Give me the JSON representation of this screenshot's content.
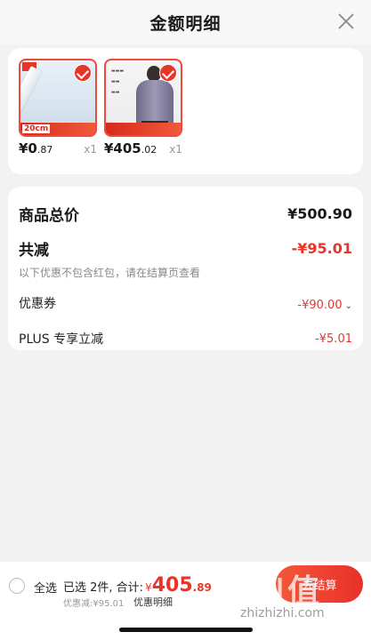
{
  "header": {
    "title": "金额明细",
    "close_icon": "close-icon"
  },
  "products": [
    {
      "price_int": "¥0",
      "price_dec": ".87",
      "qty": "x1",
      "thumb_caption": "20cm"
    },
    {
      "price_int": "¥405",
      "price_dec": ".02",
      "qty": "x1"
    }
  ],
  "summary": {
    "total_label": "商品总价",
    "total_value": "¥500.90",
    "reduce_label": "共减",
    "reduce_value": "-¥95.01",
    "note": "以下优惠不包含红包，请在结算页查看",
    "coupon_label": "优惠券",
    "coupon_value": "-¥90.00",
    "plus_label": "PLUS 专享立减",
    "plus_value": "-¥5.01"
  },
  "footer": {
    "select_all": "全选",
    "selected_text": "已选 2件, 合计:",
    "sum_symbol": "¥",
    "sum_int": "405",
    "sum_dec": ".89",
    "discount_text": "优惠减:¥95.01",
    "detail_link": "优惠明细",
    "pay_button": "去结算"
  },
  "watermark": {
    "glyphs": "值|值",
    "url": "zhizhizhi.com"
  },
  "colors": {
    "accent": "#e8352a",
    "background": "#f2f2f2"
  }
}
